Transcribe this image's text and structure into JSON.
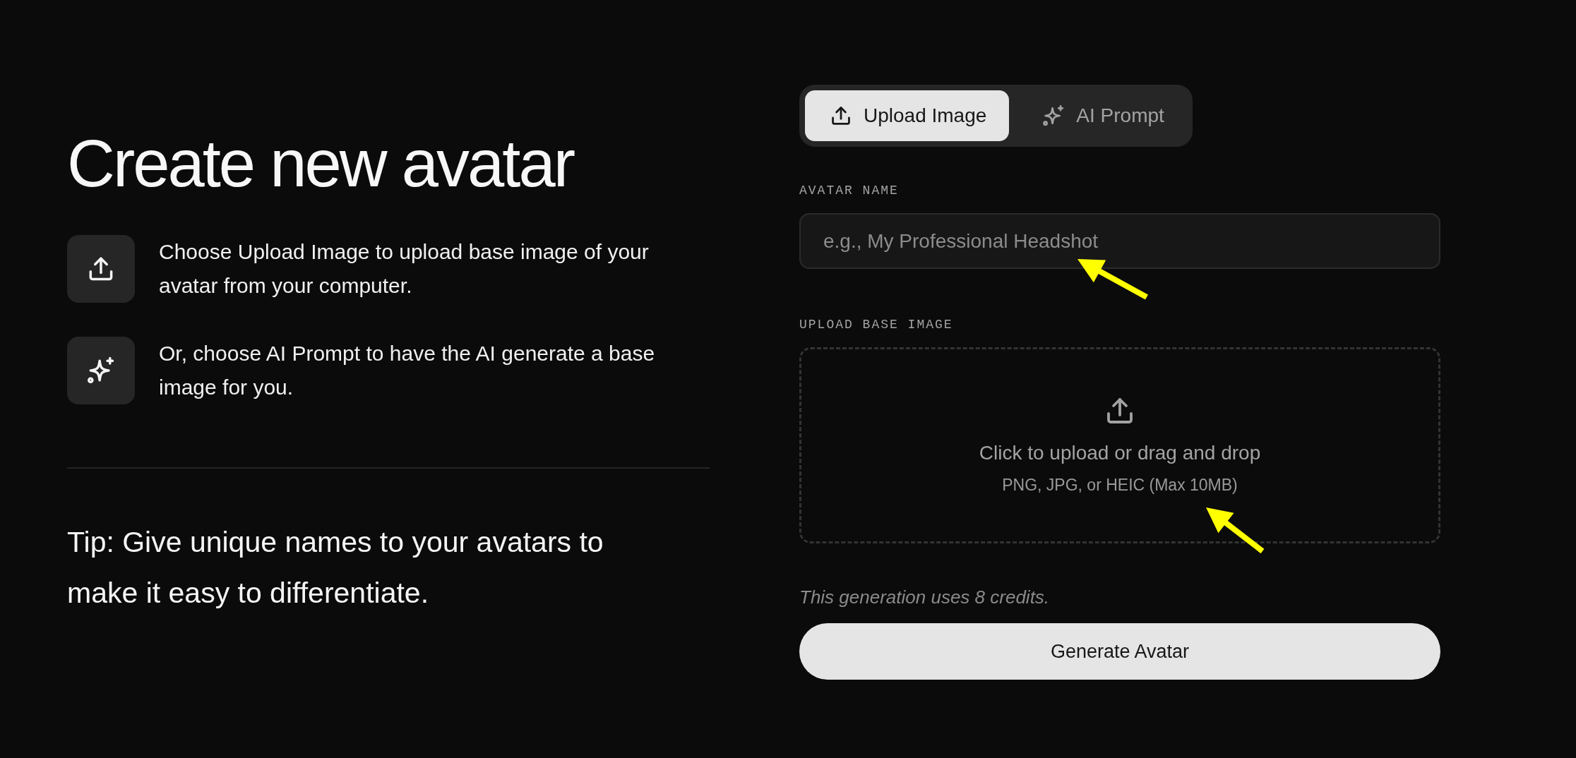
{
  "heading": "Create new avatar",
  "instructions": [
    {
      "kind": "upload",
      "text": "Choose Upload Image to upload base image of your avatar from your computer."
    },
    {
      "kind": "sparkle",
      "text": "Or, choose AI Prompt to have the AI generate a base image for you."
    }
  ],
  "tip": "Tip: Give unique names to your avatars to make it easy to differentiate.",
  "tabs": [
    {
      "kind": "upload",
      "label": "Upload Image",
      "selected": true
    },
    {
      "kind": "sparkle",
      "label": "AI Prompt",
      "selected": false
    }
  ],
  "name_field": {
    "label": "AVATAR NAME",
    "placeholder": "e.g., My Professional Headshot",
    "annotated": true
  },
  "upload": {
    "label": "UPLOAD BASE IMAGE",
    "prompt": "Click to upload or drag and drop",
    "hint": "PNG, JPG, or HEIC (Max 10MB)",
    "annotated": true
  },
  "credits_note": "This generation uses 8 credits.",
  "submit_button": "Generate Avatar"
}
